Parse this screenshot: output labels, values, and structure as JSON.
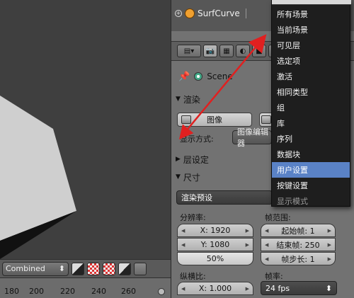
{
  "outliner": {
    "object_label": "SurfCurve"
  },
  "breadcrumb": {
    "label": "Scene"
  },
  "render_section": {
    "title": "渲染",
    "image_button": "图像",
    "display_label": "显示方式:",
    "display_value": "图像编辑器"
  },
  "layer_section": {
    "title": "层设定"
  },
  "size_section": {
    "title": "尺寸",
    "preset": "渲染预设",
    "resolution_label": "分辨率:",
    "res_x": "X: 1920",
    "res_y": "Y: 1080",
    "res_pct": "50%",
    "frame_range_label": "帧范围:",
    "start_frame": "起始帧: 1",
    "end_frame": "结束帧: 250",
    "frame_step": "帧步长: 1",
    "aspect_label": "纵横比:",
    "aspect_x": "X: 1.000",
    "fps_label": "帧率:",
    "fps_value": "24 fps"
  },
  "viewport": {
    "pass_combo": "Combined",
    "ruler": [
      "180",
      "200",
      "220",
      "240",
      "260"
    ]
  },
  "dropdown": {
    "items": [
      {
        "label": "所有场景",
        "state": "normal"
      },
      {
        "label": "当前场景",
        "state": "normal"
      },
      {
        "label": "可见层",
        "state": "normal"
      },
      {
        "label": "选定项",
        "state": "normal"
      },
      {
        "label": "激活",
        "state": "normal"
      },
      {
        "label": "相同类型",
        "state": "normal"
      },
      {
        "label": "组",
        "state": "normal"
      },
      {
        "label": "库",
        "state": "normal"
      },
      {
        "label": "序列",
        "state": "normal"
      },
      {
        "label": "数据块",
        "state": "normal"
      },
      {
        "label": "用户设置",
        "state": "selected"
      },
      {
        "label": "按键设置",
        "state": "normal"
      },
      {
        "label": "显示模式",
        "state": "disabled"
      }
    ]
  },
  "colors": {
    "menu_bg": "#1e1e1e",
    "menu_highlight": "#5a82c6",
    "annotation_arrow": "#e02020"
  }
}
